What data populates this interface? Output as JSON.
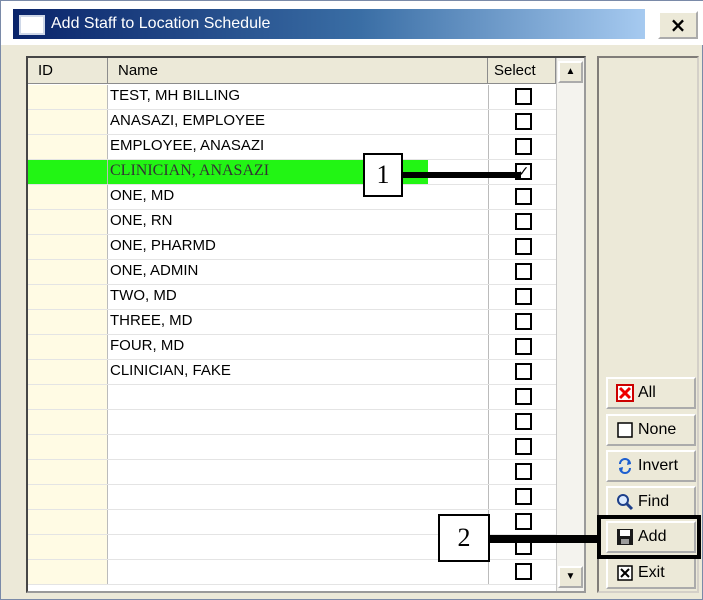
{
  "window": {
    "title": "Add Staff to Location Schedule",
    "close_label": "×"
  },
  "grid": {
    "headers": {
      "id": "ID",
      "name": "Name",
      "select": "Select"
    },
    "rows": [
      {
        "id": "",
        "name": "TEST, MH BILLING",
        "selected": false,
        "highlighted": false
      },
      {
        "id": "",
        "name": "ANASAZI, EMPLOYEE",
        "selected": false,
        "highlighted": false
      },
      {
        "id": "",
        "name": "EMPLOYEE, ANASAZI",
        "selected": false,
        "highlighted": false
      },
      {
        "id": "",
        "name": "CLINICIAN, ANASAZI",
        "selected": true,
        "highlighted": true
      },
      {
        "id": "",
        "name": "ONE, MD",
        "selected": false,
        "highlighted": false
      },
      {
        "id": "",
        "name": "ONE, RN",
        "selected": false,
        "highlighted": false
      },
      {
        "id": "",
        "name": "ONE, PHARMD",
        "selected": false,
        "highlighted": false
      },
      {
        "id": "",
        "name": "ONE, ADMIN",
        "selected": false,
        "highlighted": false
      },
      {
        "id": "",
        "name": "TWO, MD",
        "selected": false,
        "highlighted": false
      },
      {
        "id": "",
        "name": "THREE, MD",
        "selected": false,
        "highlighted": false
      },
      {
        "id": "",
        "name": "FOUR, MD",
        "selected": false,
        "highlighted": false
      },
      {
        "id": "",
        "name": "CLINICIAN, FAKE",
        "selected": false,
        "highlighted": false
      },
      {
        "id": "",
        "name": "",
        "selected": false,
        "highlighted": false
      },
      {
        "id": "",
        "name": "",
        "selected": false,
        "highlighted": false
      },
      {
        "id": "",
        "name": "",
        "selected": false,
        "highlighted": false
      },
      {
        "id": "",
        "name": "",
        "selected": false,
        "highlighted": false
      },
      {
        "id": "",
        "name": "",
        "selected": false,
        "highlighted": false
      },
      {
        "id": "",
        "name": "",
        "selected": false,
        "highlighted": false
      },
      {
        "id": "",
        "name": "",
        "selected": false,
        "highlighted": false
      },
      {
        "id": "",
        "name": "",
        "selected": false,
        "highlighted": false
      }
    ],
    "highlight_color": "#22f514"
  },
  "buttons": {
    "all": {
      "label": "All",
      "icon": "red-x-icon"
    },
    "none": {
      "label": "None",
      "icon": "empty-checkbox-icon"
    },
    "invert": {
      "label": "Invert",
      "icon": "swap-arrows-icon"
    },
    "find": {
      "label": "Find",
      "icon": "magnifier-icon"
    },
    "add": {
      "label": "Add",
      "icon": "floppy-disk-icon"
    },
    "exit": {
      "label": "Exit",
      "icon": "close-box-icon"
    }
  },
  "callouts": {
    "one": "1",
    "two": "2"
  }
}
